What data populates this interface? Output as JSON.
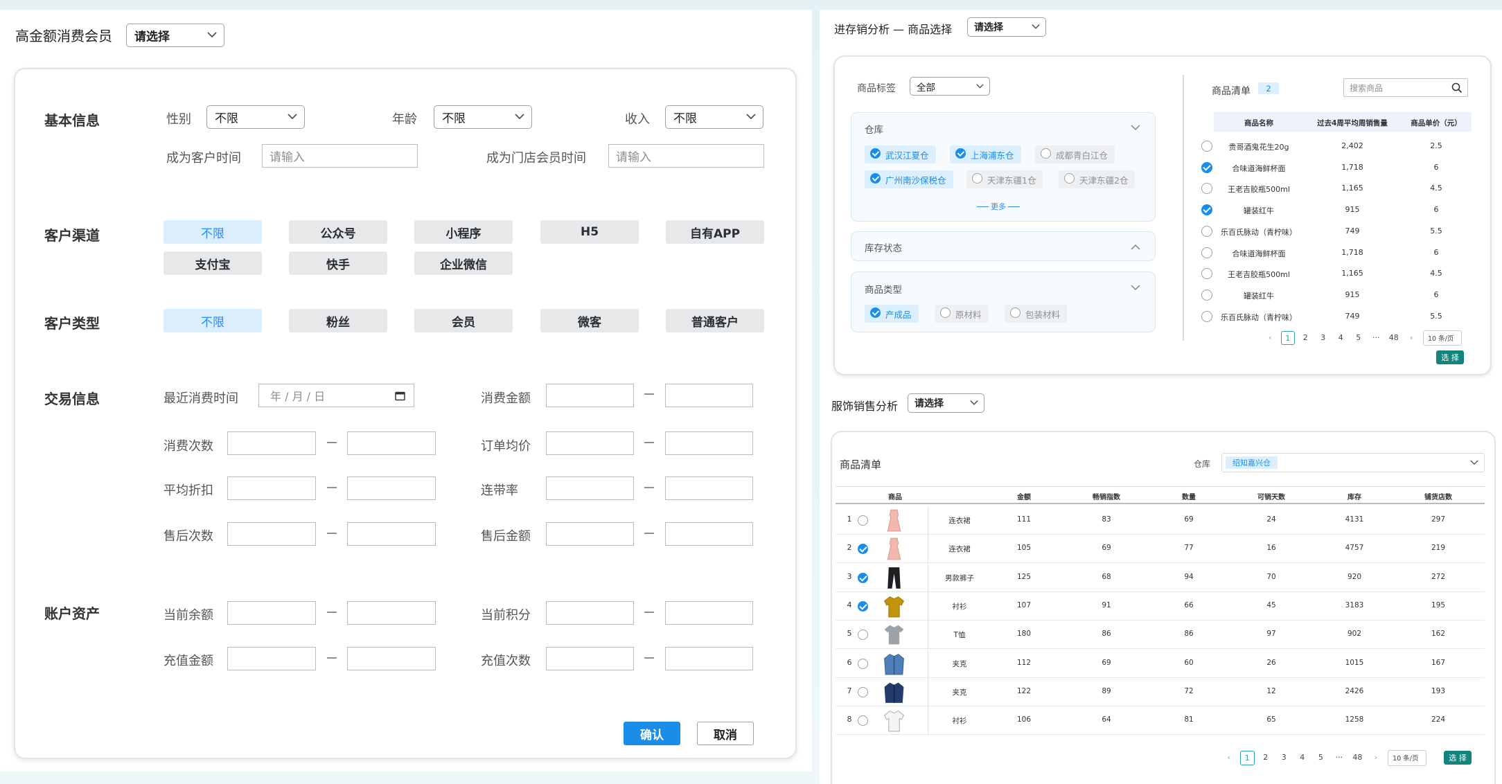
{
  "colors": {
    "accent": "#1a8de8",
    "teal": "#13857e",
    "chip_active_bg": "#dbeefe"
  },
  "left": {
    "title": "高金额消费会员",
    "title_select": "请选择",
    "basic": {
      "section": "基本信息",
      "gender_label": "性别",
      "gender_value": "不限",
      "age_label": "年龄",
      "age_value": "不限",
      "income_label": "收入",
      "income_value": "不限",
      "customer_time_label": "成为客户时间",
      "customer_time_ph": "请输入",
      "member_time_label": "成为门店会员时间",
      "member_time_ph": "请输入"
    },
    "channel": {
      "section": "客户渠道",
      "chips": [
        "不限",
        "公众号",
        "小程序",
        "H5",
        "自有APP",
        "支付宝",
        "快手",
        "企业微信"
      ]
    },
    "ctype": {
      "section": "客户类型",
      "chips": [
        "不限",
        "粉丝",
        "会员",
        "微客",
        "普通客户"
      ]
    },
    "trade": {
      "section": "交易信息",
      "recent_label": "最近消费时间",
      "date_ph": "年 / 月 / 日",
      "amount_label": "消费金额",
      "count_label": "消费次数",
      "avg_price_label": "订单均价",
      "discount_label": "平均折扣",
      "joint_rate_label": "连带率",
      "after_count_label": "售后次数",
      "after_amount_label": "售后金额"
    },
    "asset": {
      "section": "账户资产",
      "balance_label": "当前余额",
      "points_label": "当前积分",
      "recharge_amount_label": "充值金额",
      "recharge_count_label": "充值次数"
    },
    "confirm": "确认",
    "cancel": "取消"
  },
  "tr": {
    "title": "进存销分析 — 商品选择",
    "title_select": "请选择",
    "tag_label": "商品标签",
    "tag_value": "全部",
    "warehouse": {
      "title": "仓库",
      "tags": [
        {
          "label": "武汉江夏仓",
          "on": true
        },
        {
          "label": "上海浦东仓",
          "on": true
        },
        {
          "label": "成都青白江仓",
          "on": false
        },
        {
          "label": "广州南沙保税仓",
          "on": true
        },
        {
          "label": "天津东疆1仓",
          "on": false
        },
        {
          "label": "天津东疆2仓",
          "on": false
        }
      ],
      "more": "更多"
    },
    "stock_status": "库存状态",
    "ptype": {
      "title": "商品类型",
      "tags": [
        {
          "label": "产成品",
          "on": true
        },
        {
          "label": "原材料",
          "on": false
        },
        {
          "label": "包装材料",
          "on": false
        }
      ]
    },
    "list_title": "商品清单",
    "list_count": "2",
    "search_ph": "搜索商品",
    "headers": [
      "商品名称",
      "过去4周平均周销售量",
      "商品单价（元）"
    ],
    "rows": [
      {
        "name": "贵哥酒鬼花生20g",
        "qty": "2,402",
        "price": "2.5",
        "on": false
      },
      {
        "name": "合味道海鲜杯面",
        "qty": "1,718",
        "price": "6",
        "on": true
      },
      {
        "name": "王老吉胶瓶500ml",
        "qty": "1,165",
        "price": "4.5",
        "on": false
      },
      {
        "name": "罐装红牛",
        "qty": "915",
        "price": "6",
        "on": true
      },
      {
        "name": "乐百氏脉动（青柠味）",
        "qty": "749",
        "price": "5.5",
        "on": false
      },
      {
        "name": "合味道海鲜杯面",
        "qty": "1,718",
        "price": "6",
        "on": false
      },
      {
        "name": "王老吉胶瓶500ml",
        "qty": "1,165",
        "price": "4.5",
        "on": false
      },
      {
        "name": "罐装红牛",
        "qty": "915",
        "price": "6",
        "on": false
      },
      {
        "name": "乐百氏脉动（青柠味）",
        "qty": "749",
        "price": "5.5",
        "on": false
      }
    ],
    "pages": [
      "1",
      "2",
      "3",
      "4",
      "5",
      "···",
      "48"
    ],
    "prev": "‹",
    "next": "›",
    "page_size": "10 条/页",
    "select_btn": "选 择"
  },
  "br": {
    "title": "服饰销售分析",
    "title_select": "请选择",
    "list_title": "商品清单",
    "wh_label": "仓库",
    "wh_tag": "绍知嘉兴仓",
    "headers": [
      "商品",
      "金额",
      "畅销指数",
      "数量",
      "可销天数",
      "库存",
      "铺货店数"
    ],
    "rows": [
      {
        "no": "1",
        "cat": "连衣裙",
        "amt": "111",
        "idx": "83",
        "qty": "69",
        "days": "24",
        "stock": "4131",
        "stores": "297",
        "on": false,
        "item": "dress-pink"
      },
      {
        "no": "2",
        "cat": "连衣裙",
        "amt": "105",
        "idx": "69",
        "qty": "77",
        "days": "16",
        "stock": "4757",
        "stores": "219",
        "on": true,
        "item": "dress-pink"
      },
      {
        "no": "3",
        "cat": "男款裤子",
        "amt": "125",
        "idx": "68",
        "qty": "94",
        "days": "70",
        "stock": "920",
        "stores": "272",
        "on": true,
        "item": "pants-black"
      },
      {
        "no": "4",
        "cat": "衬衫",
        "amt": "107",
        "idx": "91",
        "qty": "66",
        "days": "45",
        "stock": "3183",
        "stores": "195",
        "on": true,
        "item": "shirt-yellow"
      },
      {
        "no": "5",
        "cat": "T恤",
        "amt": "180",
        "idx": "86",
        "qty": "86",
        "days": "97",
        "stock": "902",
        "stores": "162",
        "on": false,
        "item": "tshirt-gray"
      },
      {
        "no": "6",
        "cat": "夹克",
        "amt": "112",
        "idx": "69",
        "qty": "60",
        "days": "26",
        "stock": "1015",
        "stores": "167",
        "on": false,
        "item": "jacket-denim"
      },
      {
        "no": "7",
        "cat": "夹克",
        "amt": "122",
        "idx": "89",
        "qty": "72",
        "days": "12",
        "stock": "2426",
        "stores": "193",
        "on": false,
        "item": "jacket-navy"
      },
      {
        "no": "8",
        "cat": "衬衫",
        "amt": "106",
        "idx": "64",
        "qty": "81",
        "days": "65",
        "stock": "1258",
        "stores": "224",
        "on": false,
        "item": "shirt-white"
      }
    ],
    "pages": [
      "1",
      "2",
      "3",
      "4",
      "5",
      "···",
      "48"
    ],
    "prev": "‹",
    "next": "›",
    "page_size": "10 条/页",
    "select_btn": "选 择"
  }
}
